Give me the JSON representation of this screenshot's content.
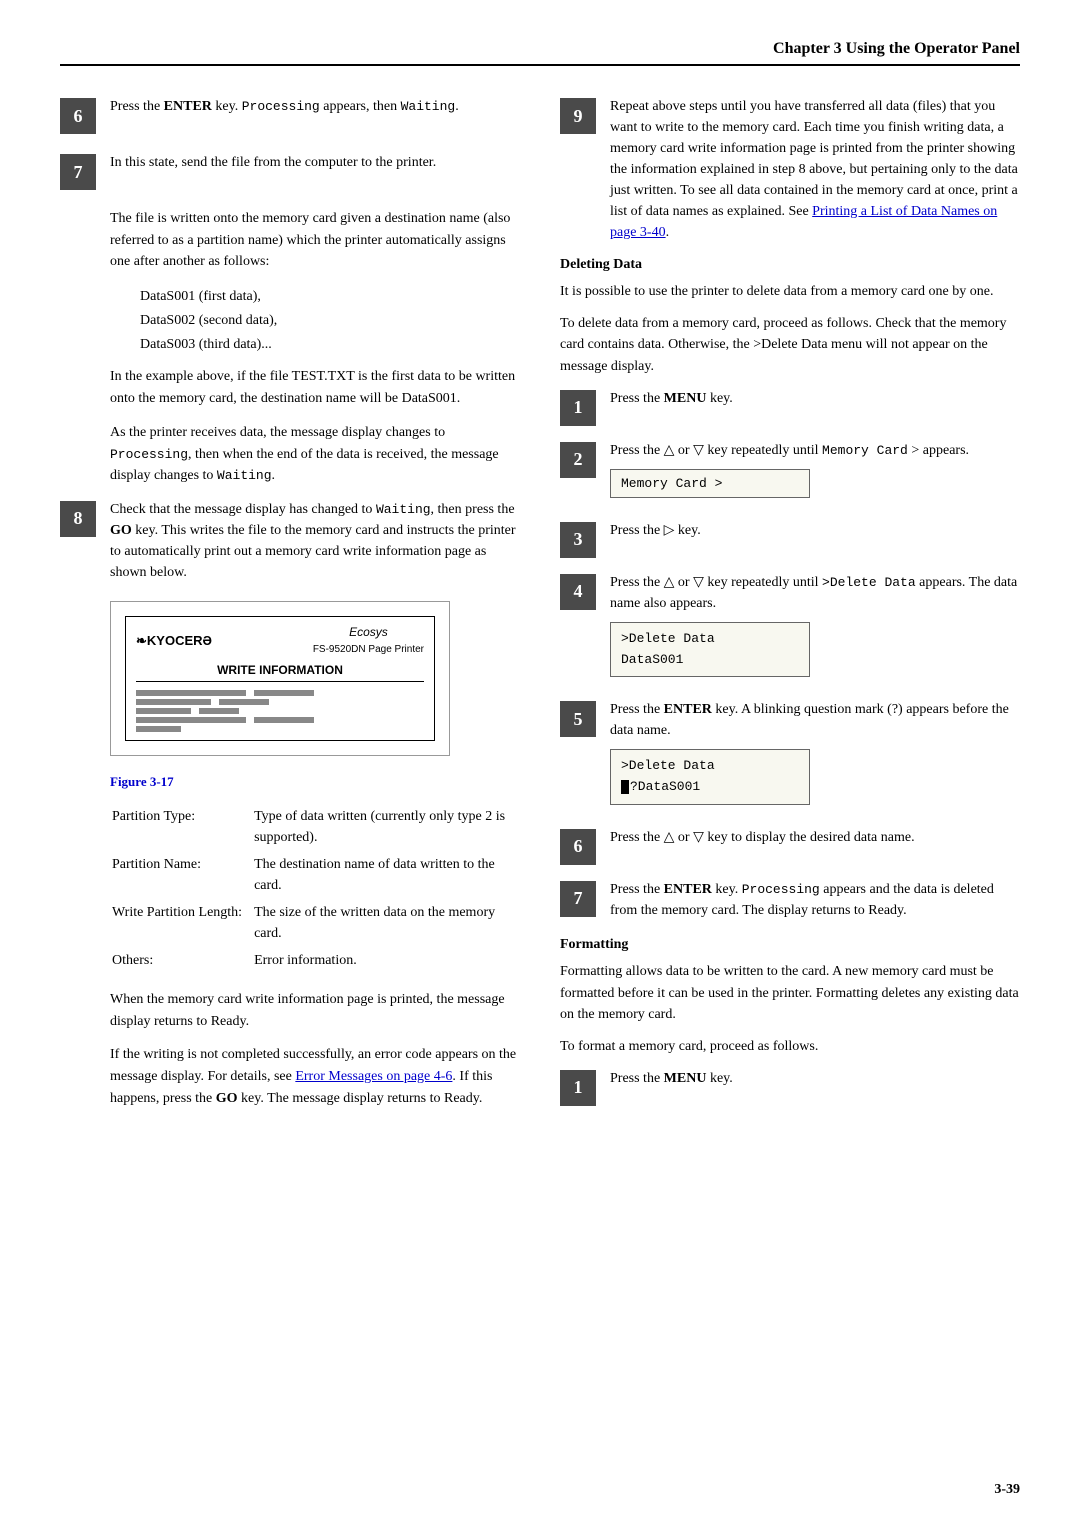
{
  "header": {
    "title": "Chapter 3  Using the Operator Panel"
  },
  "left_column": {
    "step6": {
      "number": "6",
      "text_parts": [
        "Press the ",
        "ENTER",
        " key. ",
        "Processing",
        " appears, then ",
        "Waiting",
        "."
      ]
    },
    "step7": {
      "number": "7",
      "text": "In this state, send the file from the computer to the printer."
    },
    "para1": "The file is written onto the memory card given a destination name (also referred to as a partition name) which the printer automatically assigns one after another as follows:",
    "data_list": [
      "DataS001 (first data),",
      "DataS002 (second data),",
      "DataS003 (third data)..."
    ],
    "para2": "In the example above, if the file TEST.TXT is the first data to be written onto the memory card, the destination name will be DataS001.",
    "para3": "As the printer receives data, the message display changes to Processing, then when the end of the data is received, the message display changes to Waiting.",
    "step8": {
      "number": "8",
      "text_before": "Check that the message display has changed to ",
      "waiting": "Waiting",
      "text_middle": ", then press the ",
      "go": "GO",
      "text_after": " key. This writes the file to the memory card and instructs the printer to automatically print out a memory card write information page as shown below."
    },
    "figure": {
      "kyocera": "❧KYOCERƏ",
      "ecosys": "Ecosys",
      "model": "FS-9520DN Page Printer",
      "title": "WRITE INFORMATION",
      "label": "Figure 3-17"
    },
    "field_rows": [
      {
        "label": "Partition Type:",
        "value": "Type of data written (currently only type 2 is supported)."
      },
      {
        "label": "Partition Name:",
        "value": "The destination name of data written to the card."
      },
      {
        "label": "Write Partition Length:",
        "value": "The size of the written data on the memory card."
      },
      {
        "label": "Others:",
        "value": "Error information."
      }
    ],
    "para4": "When the memory card write information page is printed, the message display returns to Ready.",
    "para5_before": "If the writing is not completed successfully, an error code appears on the message display. For details, see ",
    "para5_link": "Error Messages on page 4-6",
    "para5_after": ". If this happens, press the ",
    "para5_go": "GO",
    "para5_end": " key. The message display returns to Ready."
  },
  "right_column": {
    "step9": {
      "number": "9",
      "text": "Repeat above steps until you have transferred all data (files) that you want to write to the memory card. Each time you finish writing data, a memory card write information page is printed from the printer showing the information explained in step 8 above, but pertaining only to the data just written. To see all data contained in the memory card at once, print a list of data names as explained. See ",
      "link": "Printing a List of Data Names on page 3-40",
      "end": "."
    },
    "deleting_data": {
      "heading": "Deleting Data",
      "intro1": "It is possible to use the printer to delete data from a memory card one by one.",
      "intro2": "To delete data from a memory card, proceed as follows. Check that the memory card contains data. Otherwise, the >Delete Data menu will not appear on the message display.",
      "steps": [
        {
          "number": "1",
          "text": "Press the MENU key.",
          "bold_word": "MENU"
        },
        {
          "number": "2",
          "text_before": "Press the △ or ▽ key repeatedly until ",
          "mono": "Memory Card",
          "text_after": " > appears.",
          "lcd": "Memory Card  >"
        },
        {
          "number": "3",
          "text_before": "Press the ▷ key."
        },
        {
          "number": "4",
          "text_before": "Press the △ or ▽ key repeatedly until ",
          "mono1": ">Delete",
          "text_mid": "\nData",
          "text_after": " appears. The data name also appears.",
          "lcd_lines": [
            ">Delete Data",
            "DataS001"
          ]
        },
        {
          "number": "5",
          "text_before": "Press the ",
          "bold": "ENTER",
          "text_after": " key. A blinking question mark (?) appears before the data name.",
          "lcd_lines": [
            ">Delete Data",
            "?DataS001"
          ],
          "has_cursor": true
        },
        {
          "number": "6",
          "text": "Press the △ or ▽ key to display the desired data name."
        },
        {
          "number": "7",
          "text_before": "Press the ",
          "bold": "ENTER",
          "text_after": " key. Processing appears and the data is deleted from the memory card. The display returns to Ready."
        }
      ]
    },
    "formatting": {
      "heading": "Formatting",
      "intro1": "Formatting allows data to be written to the card. A new memory card must be formatted before it can be used in the printer. Formatting deletes any existing data on the memory card.",
      "intro2": "To format a memory card, proceed as follows.",
      "step1": {
        "number": "1",
        "text": "Press the MENU key.",
        "bold_word": "MENU"
      }
    }
  },
  "page_number": "3-39"
}
